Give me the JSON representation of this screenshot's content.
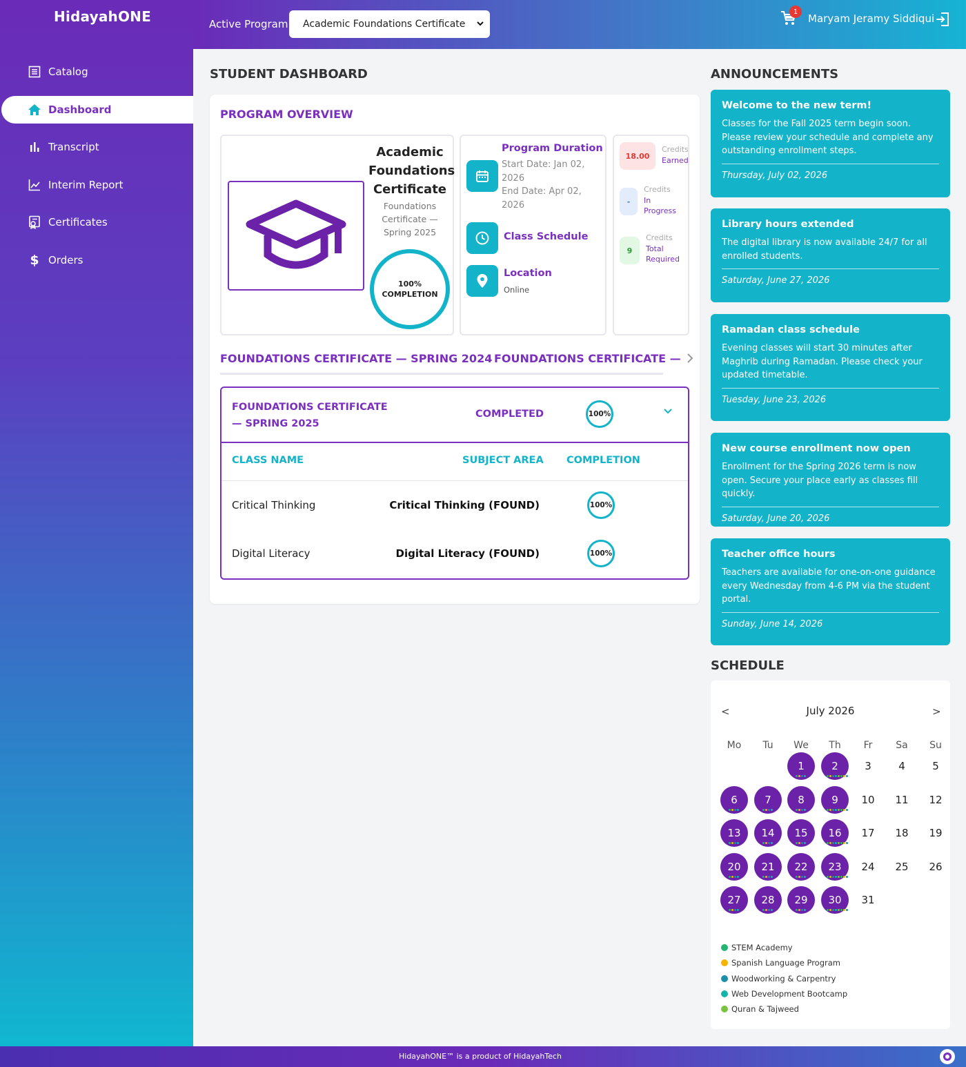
{
  "app": {
    "logo": "HidayahONE"
  },
  "sidebar": {
    "items": [
      {
        "label": "Catalog",
        "icon": "list-icon",
        "active": false
      },
      {
        "label": "Dashboard",
        "icon": "home-icon",
        "active": true
      },
      {
        "label": "Transcript",
        "icon": "bar-chart-icon",
        "active": false
      },
      {
        "label": "Interim Report",
        "icon": "line-chart-icon",
        "active": false
      },
      {
        "label": "Certificates",
        "icon": "certificate-icon",
        "active": false
      },
      {
        "label": "Orders",
        "icon": "dollar-icon",
        "active": false
      }
    ]
  },
  "header": {
    "program_label": "Active Program",
    "program_selected": "Academic Foundations Certificate",
    "cart_count": "1",
    "user_name": "Maryam Jeramy Siddiqui"
  },
  "main": {
    "title": "STUDENT DASHBOARD",
    "overview": {
      "title": "PROGRAM OVERVIEW",
      "program_name": "Academic Foundations Certificate",
      "program_sub": "Foundations Certificate — Spring 2025",
      "completion_pct": "100%",
      "completion_label": "COMPLETION",
      "duration_title": "Program Duration",
      "start_date": "Start Date: Jan 02, 2026",
      "end_date": "End Date: Apr 02, 2026",
      "schedule_title": "Class Schedule",
      "location_title": "Location",
      "location_value": "Online",
      "credits": {
        "earned_value": "18.00",
        "earned_label_1": "Credits",
        "earned_label_2": "Earned",
        "progress_value": "-",
        "progress_label_1": "Credits",
        "progress_label_2": "In",
        "progress_label_3": "Progress",
        "required_value": "9",
        "required_label_1": "Credits",
        "required_label_2": "Total",
        "required_label_3": "Required"
      }
    },
    "tabs": [
      "FOUNDATIONS CERTIFICATE — SPRING 2024",
      "FOUNDATIONS CERTIFICATE —"
    ],
    "program_table": {
      "name": "FOUNDATIONS CERTIFICATE — SPRING 2025",
      "status": "COMPLETED",
      "pct": "100%",
      "columns": [
        "CLASS NAME",
        "SUBJECT AREA",
        "COMPLETION"
      ],
      "rows": [
        {
          "class": "Critical Thinking",
          "subject": "Critical Thinking (FOUND)",
          "pct": "100%"
        },
        {
          "class": "Digital Literacy",
          "subject": "Digital Literacy (FOUND)",
          "pct": "100%"
        }
      ]
    }
  },
  "announcements": {
    "title": "ANNOUNCEMENTS",
    "items": [
      {
        "title": "Welcome to the new term!",
        "body": "Classes for the Fall 2025 term begin soon. Please review your schedule and complete any outstanding enrollment steps.",
        "date": "Thursday, July 02, 2026"
      },
      {
        "title": "Library hours extended",
        "body": "The digital library is now available 24/7 for all enrolled students.",
        "date": "Saturday, June 27, 2026"
      },
      {
        "title": "Ramadan class schedule",
        "body": "Evening classes will start 30 minutes after Maghrib during Ramadan. Please check your updated timetable.",
        "date": "Tuesday, June 23, 2026"
      },
      {
        "title": "New course enrollment now open",
        "body": "Enrollment for the Spring 2026 term is now open. Secure your place early as classes fill quickly.",
        "date": "Saturday, June 20, 2026"
      },
      {
        "title": "Teacher office hours",
        "body": "Teachers are available for one-on-one guidance every Wednesday from 4-6 PM via the student portal.",
        "date": "Sunday, June 14, 2026"
      }
    ]
  },
  "schedule": {
    "title": "SCHEDULE",
    "month": "July 2026",
    "prev": "<",
    "next": ">",
    "weekdays": [
      "Mo",
      "Tu",
      "We",
      "Th",
      "Fr",
      "Sa",
      "Su"
    ],
    "legend": [
      {
        "label": "STEM Academy",
        "color": "#22b573"
      },
      {
        "label": "Spanish Language Program",
        "color": "#f4b400"
      },
      {
        "label": "Woodworking & Carpentry",
        "color": "#1b8fa8"
      },
      {
        "label": "Web Development Bootcamp",
        "color": "#13b3a9"
      },
      {
        "label": "Quran & Tajweed",
        "color": "#7cc242"
      }
    ]
  },
  "footer": {
    "text": "HidayahONE™ is a product of HidayahTech"
  },
  "colors": {
    "primary": "#7b2fbf",
    "accent": "#13b3c9",
    "event": "#6b21a8"
  }
}
